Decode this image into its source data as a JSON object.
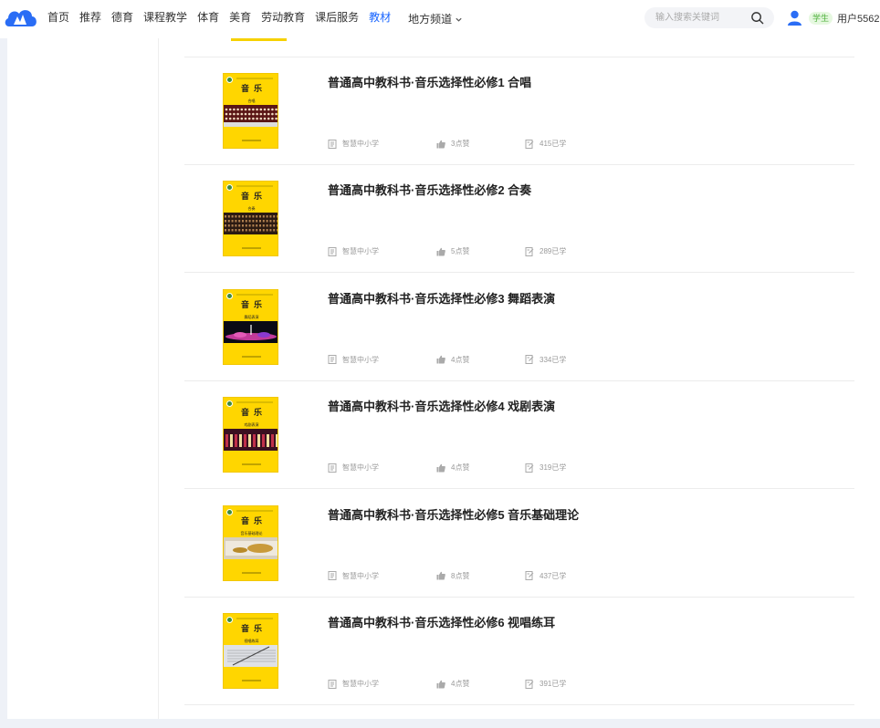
{
  "header": {
    "nav": [
      "首页",
      "推荐",
      "德育",
      "课程教学",
      "体育",
      "美育",
      "劳动教育",
      "课后服务",
      "教材"
    ],
    "active_nav": "教材",
    "dropdown_label": "地方频道",
    "search_placeholder": "输入搜索关键词",
    "role_badge": "学生",
    "username": "用户5562"
  },
  "colors": {
    "accent": "#1a66ff",
    "cover_yellow": "#ffd600",
    "badge_green": "#4caf3a"
  },
  "books": [
    {
      "title": "普通高中教科书·音乐选择性必修1 合唱",
      "cover_title": "音乐",
      "cover_vol": "合唱",
      "publisher": "智慧中小学",
      "likes": "3点赞",
      "learners": "415已学",
      "photo": "choir"
    },
    {
      "title": "普通高中教科书·音乐选择性必修2 合奏",
      "cover_title": "音乐",
      "cover_vol": "合奏",
      "publisher": "智慧中小学",
      "likes": "5点赞",
      "learners": "289已学",
      "photo": "orchestra"
    },
    {
      "title": "普通高中教科书·音乐选择性必修3 舞蹈表演",
      "cover_title": "音乐",
      "cover_vol": "舞蹈表演",
      "publisher": "智慧中小学",
      "likes": "4点赞",
      "learners": "334已学",
      "photo": "dance"
    },
    {
      "title": "普通高中教科书·音乐选择性必修4 戏剧表演",
      "cover_title": "音乐",
      "cover_vol": "戏剧表演",
      "publisher": "智慧中小学",
      "likes": "4点赞",
      "learners": "319已学",
      "photo": "drama"
    },
    {
      "title": "普通高中教科书·音乐选择性必修5 音乐基础理论",
      "cover_title": "音乐",
      "cover_vol": "音乐基础理论",
      "publisher": "智慧中小学",
      "likes": "8点赞",
      "learners": "437已学",
      "photo": "instruments"
    },
    {
      "title": "普通高中教科书·音乐选择性必修6 视唱练耳",
      "cover_title": "音乐",
      "cover_vol": "视唱练耳",
      "publisher": "智慧中小学",
      "likes": "4点赞",
      "learners": "391已学",
      "photo": "score"
    }
  ]
}
